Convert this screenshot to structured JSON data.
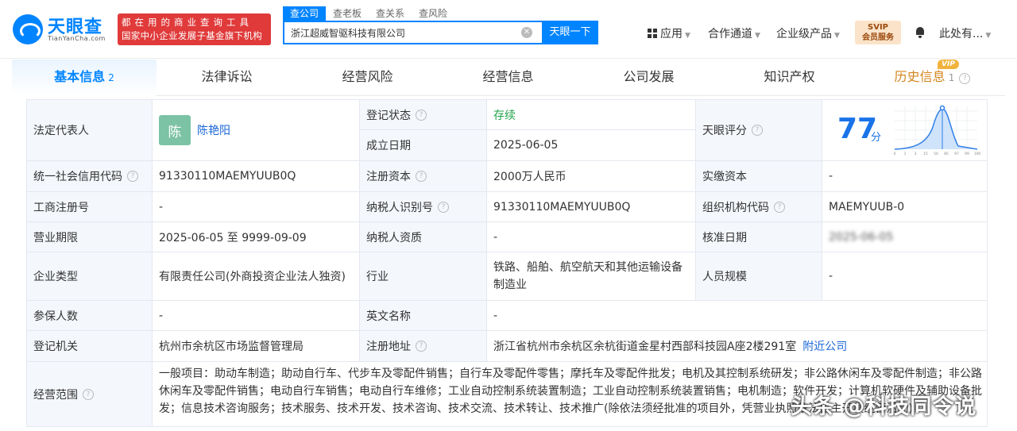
{
  "header": {
    "logo_text": "天眼查",
    "logo_sub": "TianYanCha.com",
    "slogan_line1": "都在用的商业查询工具",
    "slogan_line2": "国家中小企业发展子基金旗下机构",
    "search_tabs": [
      "查公司",
      "查老板",
      "查关系",
      "查风险"
    ],
    "search_value": "浙江超威智驱科技有限公司",
    "search_button": "天眼一下",
    "nav": {
      "apps": "应用",
      "channel": "合作通道",
      "enterprise": "企业级产品",
      "vip_line1": "SVIP",
      "vip_line2": "会员服务",
      "user": "此处有..."
    }
  },
  "tabs": [
    {
      "label": "基本信息",
      "count": "2"
    },
    {
      "label": "法律诉讼"
    },
    {
      "label": "经营风险"
    },
    {
      "label": "经营信息"
    },
    {
      "label": "公司发展"
    },
    {
      "label": "知识产权"
    },
    {
      "label": "历史信息",
      "count": "1"
    }
  ],
  "vip_tag": "VIP",
  "info": {
    "legal_rep_label": "法定代表人",
    "legal_rep_avatar": "陈",
    "legal_rep_name": "陈艳阳",
    "status_label": "登记状态",
    "status_value": "存续",
    "founded_label": "成立日期",
    "founded_value": "2025-06-05",
    "score_label": "天眼评分",
    "score_value": "77",
    "score_unit": "分",
    "score_axis": [
      "0",
      "1",
      "3",
      "15",
      "50",
      "85",
      "97",
      "99",
      "100"
    ],
    "credit_code_label": "统一社会信用代码",
    "credit_code_value": "91330110MAEMYUUB0Q",
    "capital_label": "注册资本",
    "capital_value": "2000万人民币",
    "paid_capital_label": "实缴资本",
    "paid_capital_value": "-",
    "reg_no_label": "工商注册号",
    "reg_no_value": "-",
    "tax_id_label": "纳税人识别号",
    "tax_id_value": "91330110MAEMYUUB0Q",
    "org_code_label": "组织机构代码",
    "org_code_value": "MAEMYUUB-0",
    "term_label": "营业期限",
    "term_value": "2025-06-05 至 9999-09-09",
    "taxpayer_label": "纳税人资质",
    "taxpayer_value": "-",
    "approve_label": "核准日期",
    "approve_value": "2025-06-05",
    "type_label": "企业类型",
    "type_value": "有限责任公司(外商投资企业法人独资)",
    "industry_label": "行业",
    "industry_value": "铁路、船舶、航空航天和其他运输设备制造业",
    "staff_label": "人员规模",
    "staff_value": "-",
    "insured_label": "参保人数",
    "insured_value": "-",
    "en_name_label": "英文名称",
    "en_name_value": "-",
    "authority_label": "登记机关",
    "authority_value": "杭州市余杭区市场监督管理局",
    "address_label": "注册地址",
    "address_value": "浙江省杭州市余杭区余杭街道金星村西部科技园A座2楼291室",
    "nearby_link": "附近公司",
    "scope_label": "经营范围",
    "scope_value": "一般项目：助动车制造；助动自行车、代步车及零配件销售；自行车及零配件零售；摩托车及零配件批发；电机及其控制系统研发；非公路休闲车及零配件制造；非公路休闲车及零配件销售；电动自行车销售；电动自行车维修；工业自动控制系统装置制造；工业自动控制系统装置销售；电机制造；软件开发；计算机软硬件及辅助设备批发；信息技术咨询服务；技术服务、技术开发、技术咨询、技术交流、技术转让、技术推广(除依法须经批准的项目外，凭营业执照依法自主开展经营活动)"
  },
  "watermark": "头条 @科技同令说"
}
